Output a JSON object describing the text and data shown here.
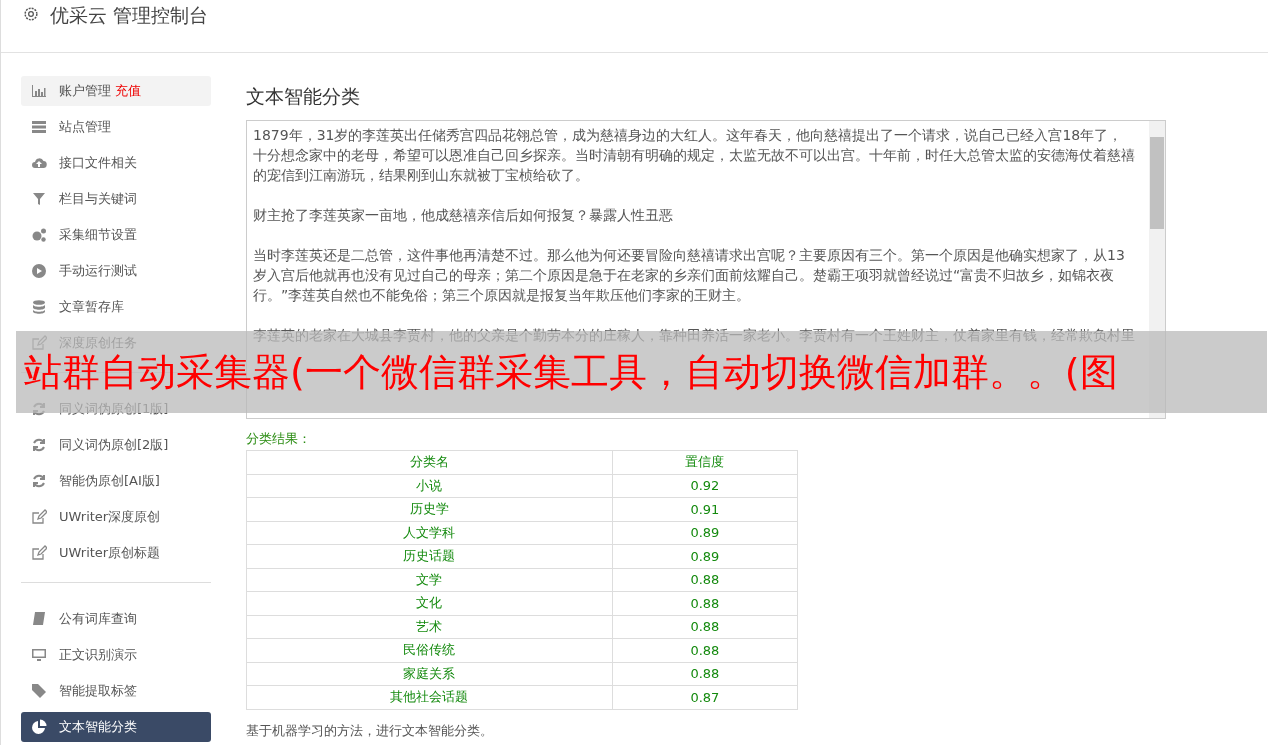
{
  "header": {
    "title": "优采云 管理控制台"
  },
  "sidebar": {
    "groups": [
      {
        "items": [
          {
            "label": "账户管理",
            "badge": "充值",
            "selected": false,
            "hover": true
          },
          {
            "label": "站点管理",
            "selected": false,
            "hover": false
          },
          {
            "label": "接口文件相关",
            "selected": false,
            "hover": false
          },
          {
            "label": "栏目与关键词",
            "selected": false,
            "hover": false
          },
          {
            "label": "采集细节设置",
            "selected": false,
            "hover": false
          },
          {
            "label": "手动运行测试",
            "selected": false,
            "hover": false
          },
          {
            "label": "文章暂存库",
            "selected": false,
            "hover": false
          },
          {
            "label": "深度原创任务",
            "selected": false,
            "hover": false
          }
        ]
      },
      {
        "items": [
          {
            "label": "同义词伪原创[1版]",
            "selected": false,
            "hover": false
          },
          {
            "label": "同义词伪原创[2版]",
            "selected": false,
            "hover": false
          },
          {
            "label": "智能伪原创[AI版]",
            "selected": false,
            "hover": false
          },
          {
            "label": "UWriter深度原创",
            "selected": false,
            "hover": false
          },
          {
            "label": "UWriter原创标题",
            "selected": false,
            "hover": false
          }
        ]
      },
      {
        "items": [
          {
            "label": "公有词库查询",
            "selected": false,
            "hover": false
          },
          {
            "label": "正文识别演示",
            "selected": false,
            "hover": false
          },
          {
            "label": "智能提取标签",
            "selected": false,
            "hover": false
          },
          {
            "label": "文本智能分类",
            "selected": true,
            "hover": false
          }
        ]
      }
    ]
  },
  "main": {
    "title": "文本智能分类",
    "text": [
      "1879年，31岁的李莲英出任储秀宫四品花翎总管，成为慈禧身边的大红人。这年春天，他向慈禧提出了一个请求，说自己已经入宫18年了，十分想念家中的老母，希望可以恩准自己回乡探亲。当时清朝有明确的规定，太监无故不可以出宫。十年前，时任大总管太监的安德海仗着慈禧的宠信到江南游玩，结果刚到山东就被丁宝桢给砍了。",
      "财主抢了李莲英家一亩地，他成慈禧亲信后如何报复？暴露人性丑恶",
      "当时李莲英还是二总管，这件事他再清楚不过。那么他为何还要冒险向慈禧请求出宫呢？主要原因有三个。第一个原因是他确实想家了，从13岁入宫后他就再也没有见过自己的母亲；第二个原因是急于在老家的乡亲们面前炫耀自己。楚霸王项羽就曾经说过“富贵不归故乡，如锦衣夜行。”李莲英自然也不能免俗；第三个原因就是报复当年欺压他们李家的王财主。",
      "李莲英的老家在大城县李贾村，他的父亲是个勤劳本分的庄稼人，靠种田养活一家老小。李贾村有一个王姓财主，仗着家里有钱，经常欺负村里"
    ],
    "result_label": "分类结果：",
    "table": {
      "columns": [
        "分类名",
        "置信度"
      ],
      "rows": [
        [
          "小说",
          "0.92"
        ],
        [
          "历史学",
          "0.91"
        ],
        [
          "人文学科",
          "0.89"
        ],
        [
          "历史话题",
          "0.89"
        ],
        [
          "文学",
          "0.88"
        ],
        [
          "文化",
          "0.88"
        ],
        [
          "艺术",
          "0.88"
        ],
        [
          "民俗传统",
          "0.88"
        ],
        [
          "家庭关系",
          "0.88"
        ],
        [
          "其他社会话题",
          "0.87"
        ]
      ]
    },
    "note": "基于机器学习的方法，进行文本智能分类。"
  },
  "banner": {
    "text": "站群自动采集器(一个微信群采集工具，自动切换微信加群。。(图"
  }
}
